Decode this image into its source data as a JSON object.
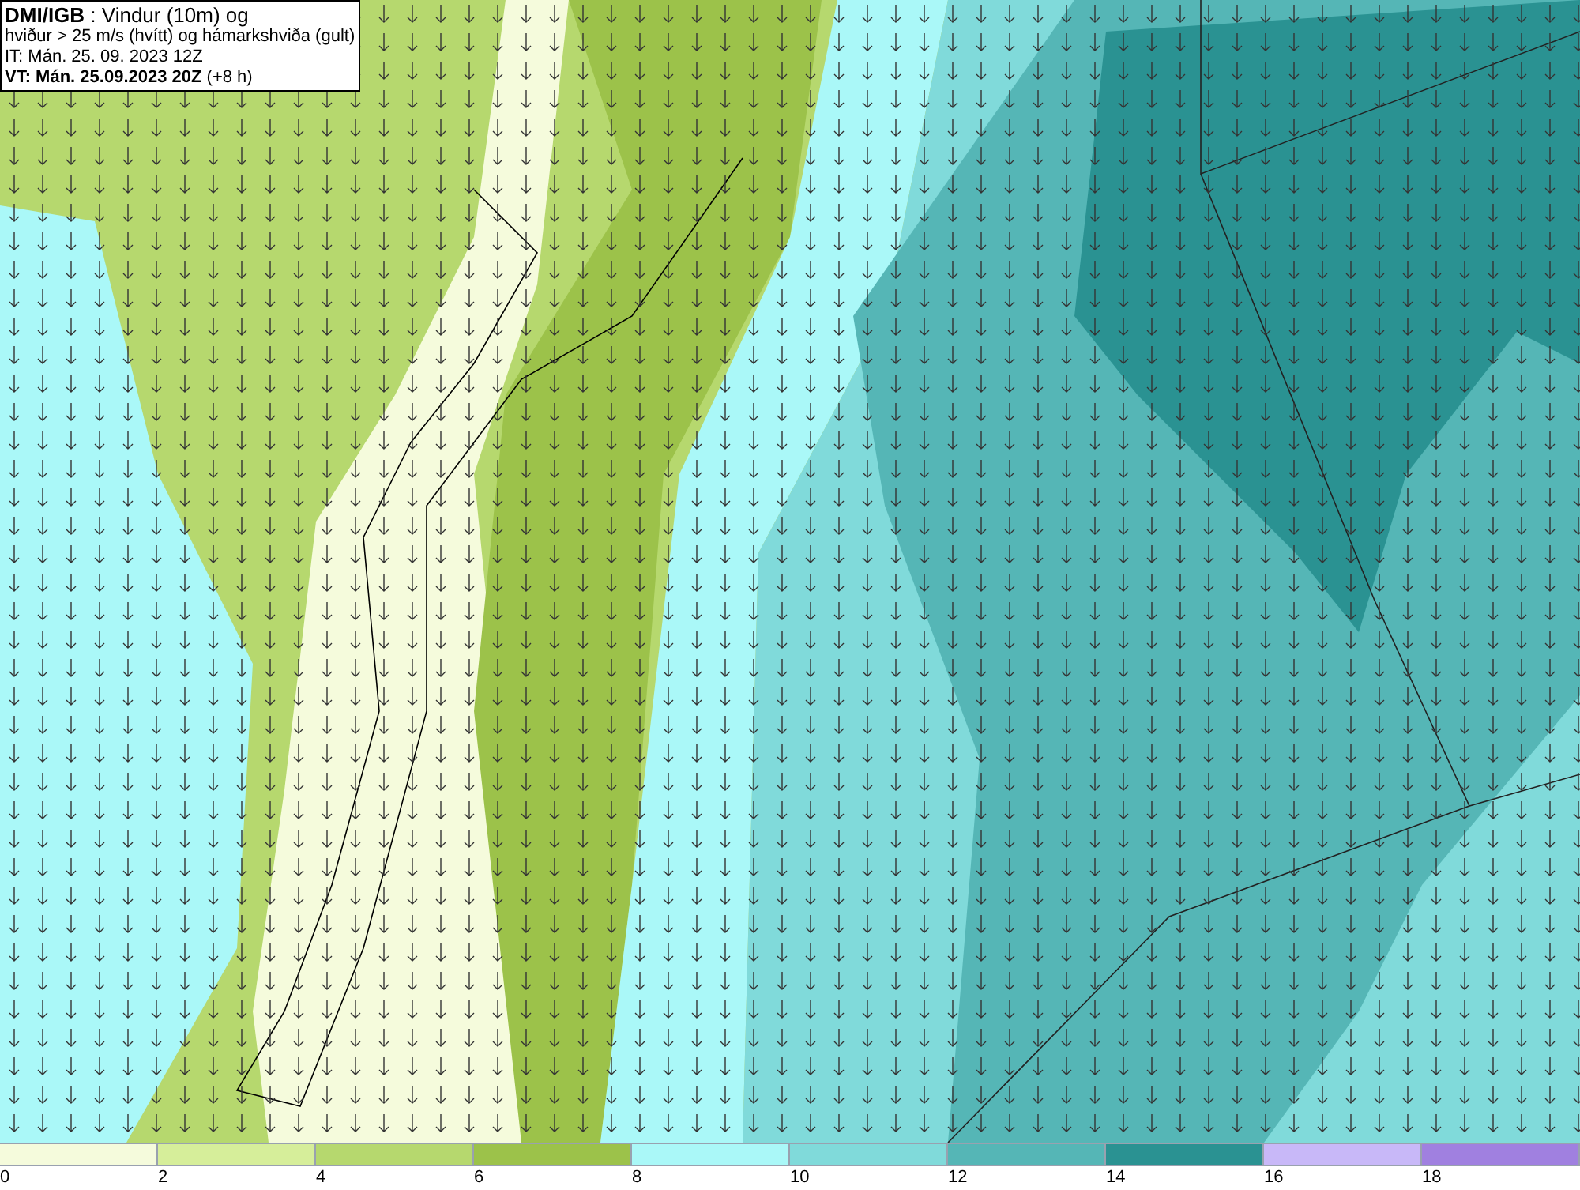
{
  "title_box": {
    "lines": [
      "**DMI/IGB** : Vindur (10m) og",
      "hviður > 25 m/s (hvítt) og hámarkshviða (gult)",
      "IT: Mán. 25. 09. 2023 12Z",
      "**VT: Mán. 25.09.2023 20Z** (+8 h)"
    ]
  },
  "legend": {
    "bins": [
      {
        "label": "0",
        "color": "#f5fbdc"
      },
      {
        "label": "2",
        "color": "#d6ee9a"
      },
      {
        "label": "4",
        "color": "#b6d86e"
      },
      {
        "label": "6",
        "color": "#9cc24a"
      },
      {
        "label": "8",
        "color": "#aaf8f8"
      },
      {
        "label": "10",
        "color": "#80dada"
      },
      {
        "label": "12",
        "color": "#55b6b6"
      },
      {
        "label": "14",
        "color": "#2a9292"
      },
      {
        "label": "16",
        "color": "#c8b8f8"
      },
      {
        "label": "18",
        "color": "#a080e0"
      }
    ]
  }
}
